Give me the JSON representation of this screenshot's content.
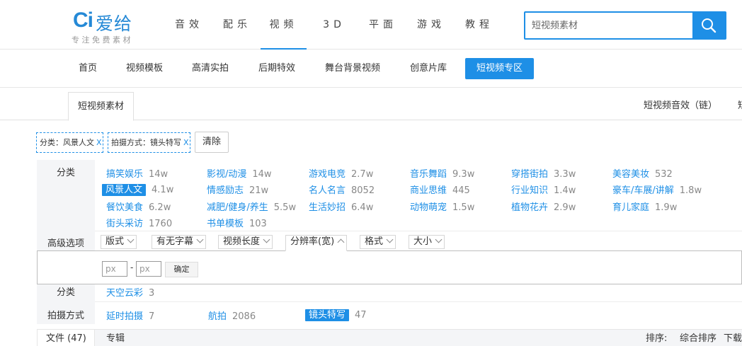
{
  "logo": {
    "mark": "Ci",
    "name": "爱给",
    "slogan": "专注免费素材"
  },
  "nav": {
    "items": [
      "音效",
      "配乐",
      "视频",
      "3D",
      "平面",
      "游戏",
      "教程"
    ],
    "active": "视频"
  },
  "search": {
    "placeholder": "短视频素材",
    "icon": "search-icon"
  },
  "subnav": {
    "items": [
      "首页",
      "视频模板",
      "高清实拍",
      "后期特效",
      "舞台背景视频",
      "创意片库",
      "短视频专区"
    ],
    "active": "短视频专区"
  },
  "tabs": {
    "main": "短视频素材",
    "right": "短视频音效（链）",
    "right_clip": "短"
  },
  "chips": {
    "chip1": "分类：风景人文",
    "chip2": "拍摄方式：镜头特写",
    "close": "X",
    "clear": "清除"
  },
  "filters": {
    "category_label": "分类",
    "categories": [
      {
        "name": "搞笑娱乐",
        "count": "14w"
      },
      {
        "name": "影视/动漫",
        "count": "14w"
      },
      {
        "name": "游戏电竞",
        "count": "2.7w"
      },
      {
        "name": "音乐舞蹈",
        "count": "9.3w"
      },
      {
        "name": "穿搭街拍",
        "count": "3.3w"
      },
      {
        "name": "美容美妆",
        "count": "532"
      },
      {
        "name": "风景人文",
        "count": "4.1w",
        "selected": true
      },
      {
        "name": "情感励志",
        "count": "21w"
      },
      {
        "name": "名人名言",
        "count": "8052"
      },
      {
        "name": "商业思维",
        "count": "445"
      },
      {
        "name": "行业知识",
        "count": "1.4w"
      },
      {
        "name": "豪车/车展/讲解",
        "count": "1.8w"
      },
      {
        "name": "餐饮美食",
        "count": "6.2w"
      },
      {
        "name": "减肥/健身/养生",
        "count": "5.5w"
      },
      {
        "name": "生活妙招",
        "count": "6.4w"
      },
      {
        "name": "动物萌宠",
        "count": "1.5w"
      },
      {
        "name": "植物花卉",
        "count": "2.9w"
      },
      {
        "name": "育儿家庭",
        "count": "1.9w"
      },
      {
        "name": "街头采访",
        "count": "1760"
      },
      {
        "name": "书单模板",
        "count": "103"
      }
    ],
    "advanced_label": "高级选项",
    "advanced": [
      "版式",
      "有无字幕",
      "视频长度",
      "分辨率(宽)",
      "格式",
      "大小"
    ],
    "advanced_open": "分辨率(宽)",
    "resolution": {
      "placeholder_min": "px",
      "placeholder_max": "px",
      "dash": "-",
      "confirm": "确定"
    },
    "subcategory_label": "分类",
    "subcategories": [
      {
        "name": "天空云彩",
        "count": "3"
      }
    ],
    "method_label": "拍摄方式",
    "methods": [
      {
        "name": "延时拍摄",
        "count": "7"
      },
      {
        "name": "航拍",
        "count": "2086"
      },
      {
        "name": "镜头特写",
        "count": "47",
        "selected": true
      }
    ]
  },
  "bottom": {
    "files_tab": "文件 (47)",
    "album_tab": "专辑",
    "sort_label": "排序:",
    "sort_value": "综合排序",
    "download": "下载"
  },
  "colors": {
    "accent": "#1e8fe6",
    "label_bg": "#f4f5f7"
  }
}
